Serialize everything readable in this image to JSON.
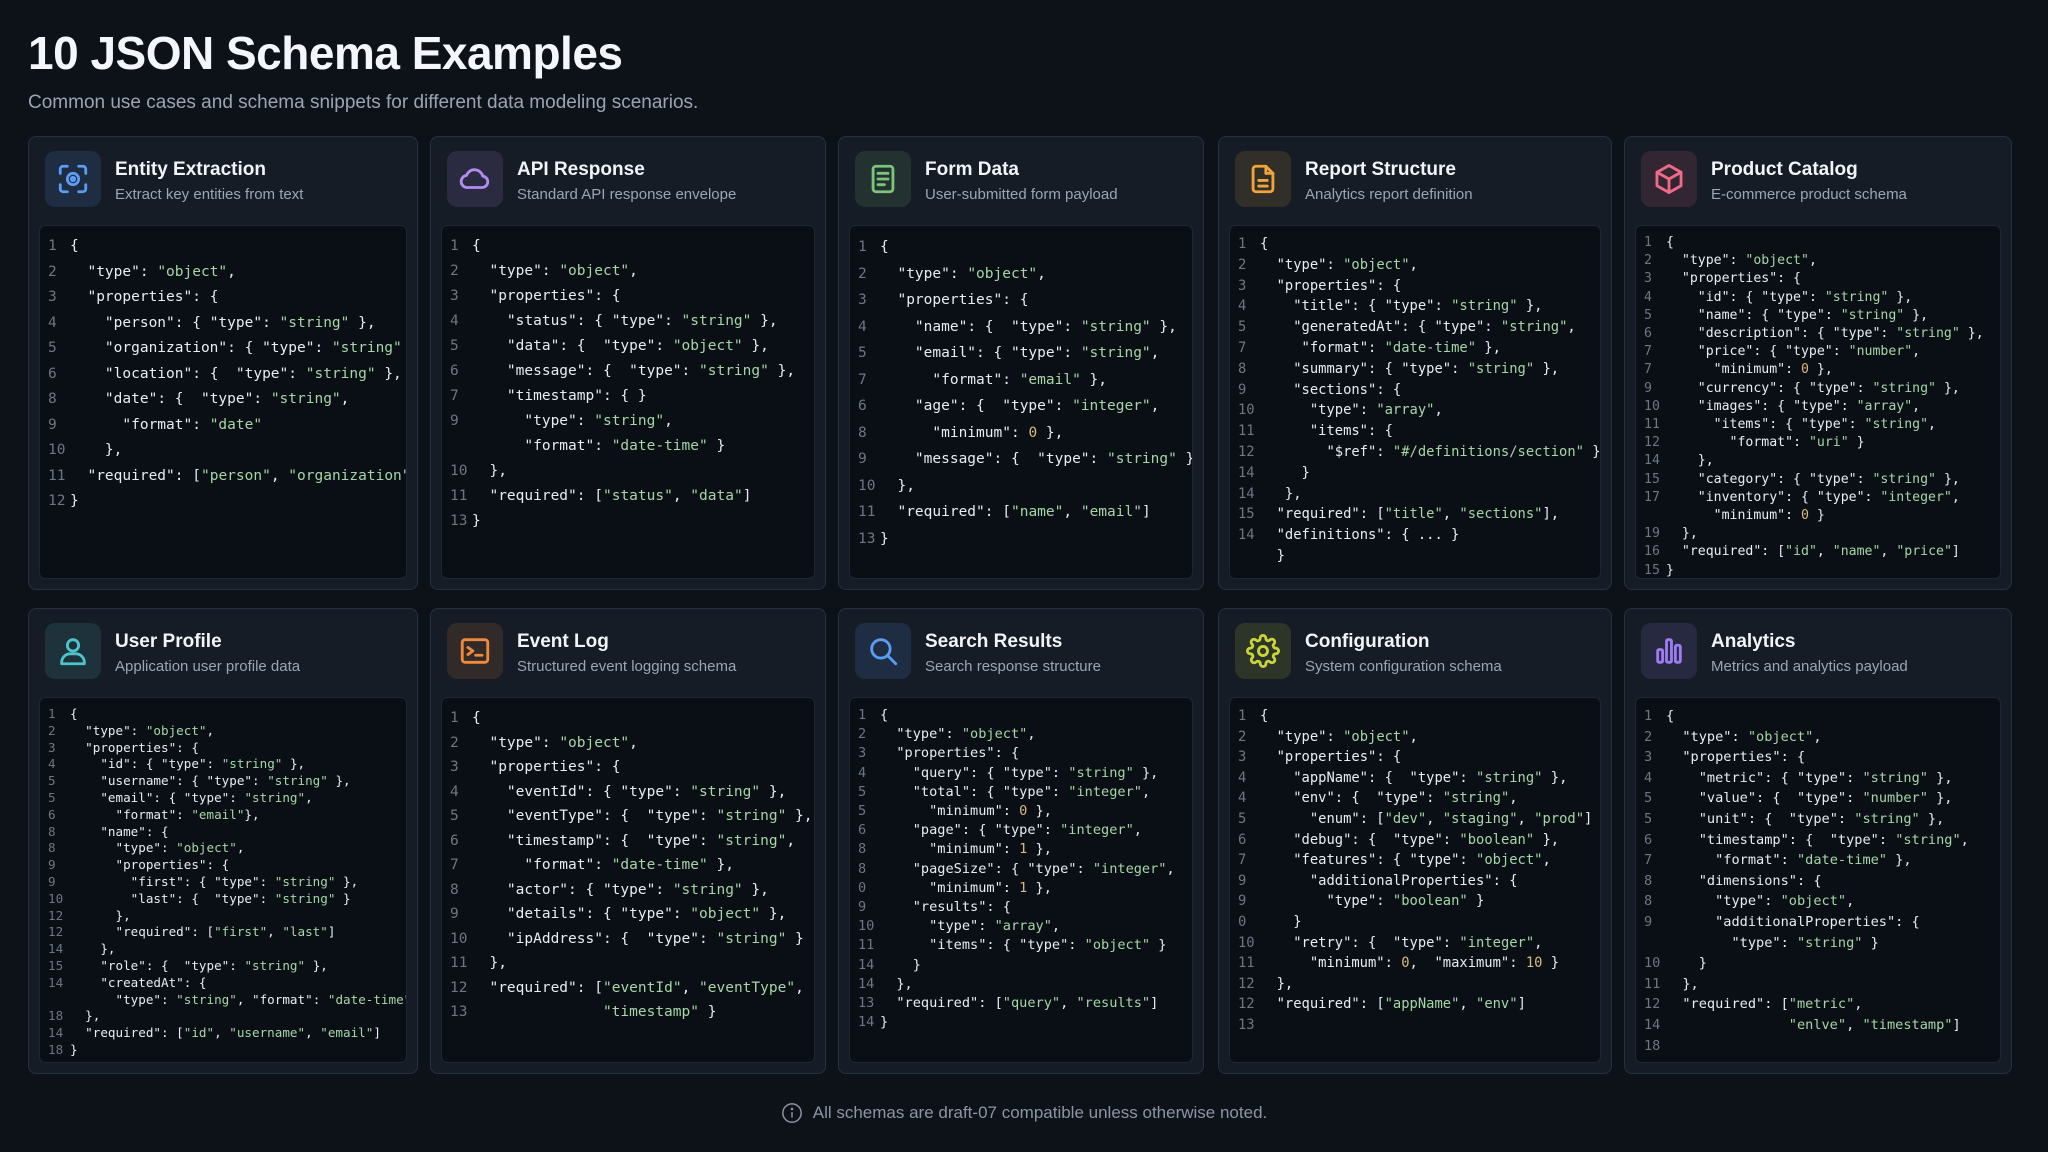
{
  "header": {
    "title": "10 JSON Schema Examples",
    "subtitle": "Common use cases and schema snippets for different data modeling scenarios."
  },
  "colors": {
    "background": "#0d1219",
    "card": "#151c26",
    "code_bg": "#0a0f16",
    "string": "#a5d6a7",
    "number": "#d7ba7d"
  },
  "cards": [
    {
      "title": "Entity Extraction",
      "description": "Extract key entities from text",
      "icon": "scan-icon",
      "accent": "#5b9cf5",
      "lines": [
        [
          "1",
          "{"
        ],
        [
          "2",
          "  \"type\": \"object\","
        ],
        [
          "3",
          "  \"properties\": {"
        ],
        [
          "4",
          "    \"person\": { \"type\": \"string\" },"
        ],
        [
          "5",
          "    \"organization\": { \"type\": \"string\" },"
        ],
        [
          "6",
          "    \"location\": {  \"type\": \"string\" },"
        ],
        [
          "8",
          "    \"date\": {  \"type\": \"string\","
        ],
        [
          "9",
          "      \"format\": \"date\""
        ],
        [
          "10",
          "    },"
        ],
        [
          "11",
          "  \"required\": [\"person\", \"organization\"]"
        ],
        [
          "12",
          "}"
        ]
      ]
    },
    {
      "title": "API Response",
      "description": "Standard API response envelope",
      "icon": "cloud-icon",
      "accent": "#b38cf2",
      "lines": [
        [
          "1",
          "{"
        ],
        [
          "2",
          "  \"type\": \"object\","
        ],
        [
          "3",
          "  \"properties\": {"
        ],
        [
          "4",
          "    \"status\": { \"type\": \"string\" },"
        ],
        [
          "5",
          "    \"data\": {  \"type\": \"object\" },"
        ],
        [
          "6",
          "    \"message\": {  \"type\": \"string\" },"
        ],
        [
          "7",
          "    \"timestamp\": { }"
        ],
        [
          "9",
          "      \"type\": \"string\","
        ],
        [
          "",
          "      \"format\": \"date-time\" }"
        ],
        [
          "10",
          "  },"
        ],
        [
          "11",
          "  \"required\": [\"status\", \"data\"]"
        ],
        [
          "13",
          "}"
        ]
      ]
    },
    {
      "title": "Form Data",
      "description": "User-submitted form payload",
      "icon": "form-icon",
      "accent": "#7cc47a",
      "lines": [
        [
          "1",
          "{"
        ],
        [
          "2",
          "  \"type\": \"object\","
        ],
        [
          "3",
          "  \"properties\": {"
        ],
        [
          "4",
          "    \"name\": {  \"type\": \"string\" },"
        ],
        [
          "5",
          "    \"email\": { \"type\": \"string\","
        ],
        [
          "7",
          "      \"format\": \"email\" },"
        ],
        [
          "6",
          "    \"age\": {  \"type\": \"integer\","
        ],
        [
          "8",
          "      \"minimum\": 0 },"
        ],
        [
          "9",
          "    \"message\": {  \"type\": \"string\" }"
        ],
        [
          "10",
          "  },"
        ],
        [
          "11",
          "  \"required\": [\"name\", \"email\"]"
        ],
        [
          "13",
          "}"
        ]
      ]
    },
    {
      "title": "Report Structure",
      "description": "Analytics report definition",
      "icon": "document-icon",
      "accent": "#f0a53c",
      "lines": [
        [
          "1",
          "{"
        ],
        [
          "2",
          "  \"type\": \"object\","
        ],
        [
          "3",
          "  \"properties\": {"
        ],
        [
          "4",
          "    \"title\": { \"type\": \"string\" },"
        ],
        [
          "5",
          "    \"generatedAt\": { \"type\": \"string\","
        ],
        [
          "7",
          "     \"format\": \"date-time\" },"
        ],
        [
          "8",
          "    \"summary\": { \"type\": \"string\" },"
        ],
        [
          "9",
          "    \"sections\": {"
        ],
        [
          "10",
          "      \"type\": \"array\","
        ],
        [
          "11",
          "      \"items\": {"
        ],
        [
          "12",
          "        \"$ref\": \"#/definitions/section\" }"
        ],
        [
          "14",
          "     }"
        ],
        [
          "14",
          "   },"
        ],
        [
          "15",
          "  \"required\": [\"title\", \"sections\"],"
        ],
        [
          "14",
          "  \"definitions\": { ... }"
        ],
        [
          "",
          "  }"
        ]
      ]
    },
    {
      "title": "Product Catalog",
      "description": "E-commerce product schema",
      "icon": "cube-icon",
      "accent": "#f06b8a",
      "lines": [
        [
          "1",
          "{"
        ],
        [
          "2",
          "  \"type\": \"object\","
        ],
        [
          "3",
          "  \"properties\": {"
        ],
        [
          "4",
          "    \"id\": { \"type\": \"string\" },"
        ],
        [
          "5",
          "    \"name\": { \"type\": \"string\" },"
        ],
        [
          "6",
          "    \"description\": { \"type\": \"string\" },"
        ],
        [
          "7",
          "    \"price\": { \"type\": \"number\","
        ],
        [
          "7",
          "      \"minimum\": 0 },"
        ],
        [
          "9",
          "    \"currency\": { \"type\": \"string\" },"
        ],
        [
          "10",
          "    \"images\": { \"type\": \"array\","
        ],
        [
          "11",
          "      \"items\": { \"type\": \"string\","
        ],
        [
          "12",
          "        \"format\": \"uri\" }"
        ],
        [
          "14",
          "    },"
        ],
        [
          "15",
          "    \"category\": { \"type\": \"string\" },"
        ],
        [
          "17",
          "    \"inventory\": { \"type\": \"integer\","
        ],
        [
          "",
          "      \"minimum\": 0 }"
        ],
        [
          "19",
          "  },"
        ],
        [
          "16",
          "  \"required\": [\"id\", \"name\", \"price\"]"
        ],
        [
          "15",
          "}"
        ]
      ]
    },
    {
      "title": "User Profile",
      "description": "Application user profile data",
      "icon": "user-icon",
      "accent": "#4fc3c9",
      "lines": [
        [
          "1",
          "{"
        ],
        [
          "2",
          "  \"type\": \"object\","
        ],
        [
          "3",
          "  \"properties\": {"
        ],
        [
          "4",
          "    \"id\": { \"type\": \"string\" },"
        ],
        [
          "5",
          "    \"username\": { \"type\": \"string\" },"
        ],
        [
          "5",
          "    \"email\": { \"type\": \"string\","
        ],
        [
          "6",
          "      \"format\": \"email\"},"
        ],
        [
          "8",
          "    \"name\": {"
        ],
        [
          "8",
          "      \"type\": \"object\","
        ],
        [
          "9",
          "      \"properties\": {"
        ],
        [
          "9",
          "        \"first\": { \"type\": \"string\" },"
        ],
        [
          "10",
          "        \"last\": {  \"type\": \"string\" }"
        ],
        [
          "12",
          "      },"
        ],
        [
          "12",
          "      \"required\": [\"first\", \"last\"]"
        ],
        [
          "14",
          "    },"
        ],
        [
          "15",
          "    \"role\": {  \"type\": \"string\" },"
        ],
        [
          "14",
          "    \"createdAt\": {"
        ],
        [
          "",
          "      \"type\": \"string\", \"format\": \"date-time\"}"
        ],
        [
          "18",
          "  },"
        ],
        [
          "14",
          "  \"required\": [\"id\", \"username\", \"email\"]"
        ],
        [
          "18",
          "}"
        ]
      ]
    },
    {
      "title": "Event Log",
      "description": "Structured event logging schema",
      "icon": "terminal-icon",
      "accent": "#f08a3c",
      "lines": [
        [
          "1",
          "{"
        ],
        [
          "2",
          "  \"type\": \"object\","
        ],
        [
          "3",
          "  \"properties\": {"
        ],
        [
          "4",
          "    \"eventId\": { \"type\": \"string\" },"
        ],
        [
          "5",
          "    \"eventType\": {  \"type\": \"string\" },"
        ],
        [
          "6",
          "    \"timestamp\": {  \"type\": \"string\","
        ],
        [
          "7",
          "      \"format\": \"date-time\" },"
        ],
        [
          "8",
          "    \"actor\": { \"type\": \"string\" },"
        ],
        [
          "9",
          "    \"details\": { \"type\": \"object\" },"
        ],
        [
          "10",
          "    \"ipAddress\": {  \"type\": \"string\" }"
        ],
        [
          "11",
          "  },"
        ],
        [
          "12",
          "  \"required\": [\"eventId\", \"eventType\","
        ],
        [
          "13",
          "               \"timestamp\" }"
        ]
      ]
    },
    {
      "title": "Search Results",
      "description": "Search response structure",
      "icon": "search-icon",
      "accent": "#5b9cf5",
      "lines": [
        [
          "1",
          "{"
        ],
        [
          "2",
          "  \"type\": \"object\","
        ],
        [
          "3",
          "  \"properties\": {"
        ],
        [
          "4",
          "    \"query\": { \"type\": \"string\" },"
        ],
        [
          "5",
          "    \"total\": { \"type\": \"integer\","
        ],
        [
          "5",
          "      \"minimum\": 0 },"
        ],
        [
          "6",
          "    \"page\": { \"type\": \"integer\","
        ],
        [
          "8",
          "      \"minimum\": 1 },"
        ],
        [
          "8",
          "    \"pageSize\": { \"type\": \"integer\","
        ],
        [
          "0",
          "      \"minimum\": 1 },"
        ],
        [
          "9",
          "    \"results\": {"
        ],
        [
          "10",
          "      \"type\": \"array\","
        ],
        [
          "11",
          "      \"items\": { \"type\": \"object\" }"
        ],
        [
          "14",
          "    }"
        ],
        [
          "14",
          "  },"
        ],
        [
          "13",
          "  \"required\": [\"query\", \"results\"]"
        ],
        [
          "14",
          "}"
        ]
      ]
    },
    {
      "title": "Configuration",
      "description": "System configuration schema",
      "icon": "gear-icon",
      "accent": "#c9d43c",
      "lines": [
        [
          "1",
          "{"
        ],
        [
          "2",
          "  \"type\": \"object\","
        ],
        [
          "3",
          "  \"properties\": {"
        ],
        [
          "4",
          "    \"appName\": {  \"type\": \"string\" },"
        ],
        [
          "4",
          "    \"env\": {  \"type\": \"string\","
        ],
        [
          "5",
          "      \"enum\": [\"dev\", \"staging\", \"prod\"] },"
        ],
        [
          "6",
          "    \"debug\": {  \"type\": \"boolean\" },"
        ],
        [
          "7",
          "    \"features\": { \"type\": \"object\","
        ],
        [
          "9",
          "      \"additionalProperties\": {"
        ],
        [
          "9",
          "        \"type\": \"boolean\" }"
        ],
        [
          "0",
          "    }"
        ],
        [
          "10",
          "    \"retry\": {  \"type\": \"integer\","
        ],
        [
          "11",
          "      \"minimum\": 0,  \"maximum\": 10 }"
        ],
        [
          "12",
          "  },"
        ],
        [
          "12",
          "  \"required\": [\"appName\", \"env\"]"
        ],
        [
          "13",
          ""
        ]
      ]
    },
    {
      "title": "Analytics",
      "description": "Metrics and analytics payload",
      "icon": "bar-chart-icon",
      "accent": "#9d7cf2",
      "lines": [
        [
          "1",
          "{"
        ],
        [
          "2",
          "  \"type\": \"object\","
        ],
        [
          "3",
          "  \"properties\": {"
        ],
        [
          "4",
          "    \"metric\": { \"type\": \"string\" },"
        ],
        [
          "5",
          "    \"value\": {  \"type\": \"number\" },"
        ],
        [
          "5",
          "    \"unit\": {  \"type\": \"string\" },"
        ],
        [
          "6",
          "    \"timestamp\": {  \"type\": \"string\","
        ],
        [
          "7",
          "      \"format\": \"date-time\" },"
        ],
        [
          "8",
          "    \"dimensions\": {"
        ],
        [
          "8",
          "      \"type\": \"object\","
        ],
        [
          "9",
          "      \"additionalProperties\": {"
        ],
        [
          "",
          "        \"type\": \"string\" }"
        ],
        [
          "10",
          "    }"
        ],
        [
          "11",
          "  },"
        ],
        [
          "12",
          "  \"required\": [\"metric\","
        ],
        [
          "14",
          "               \"enlve\", \"timestamp\"]"
        ],
        [
          "18",
          ""
        ]
      ]
    }
  ],
  "footer": {
    "icon": "info-icon",
    "text": "All schemas are draft-07 compatible unless otherwise noted."
  }
}
